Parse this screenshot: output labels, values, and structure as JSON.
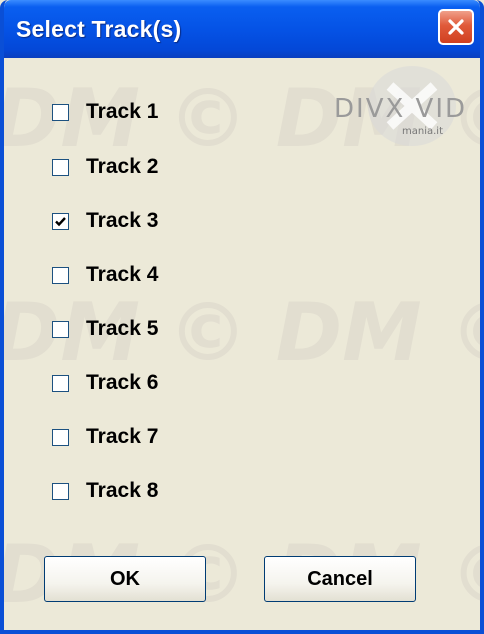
{
  "window": {
    "title": "Select Track(s)",
    "close_icon": "close-icon"
  },
  "watermark": {
    "text": "DM © DM ©",
    "logo_main": "DIVX VID",
    "logo_sub": "mania.it"
  },
  "tracks": [
    {
      "label": "Track 1",
      "checked": false
    },
    {
      "label": "Track 2",
      "checked": false
    },
    {
      "label": "Track 3",
      "checked": true
    },
    {
      "label": "Track 4",
      "checked": false
    },
    {
      "label": "Track 5",
      "checked": false
    },
    {
      "label": "Track 6",
      "checked": false
    },
    {
      "label": "Track 7",
      "checked": false
    },
    {
      "label": "Track 8",
      "checked": false
    }
  ],
  "buttons": {
    "ok_label": "OK",
    "cancel_label": "Cancel"
  },
  "colors": {
    "titlebar": "#0553e6",
    "dialog_bg": "#ece9d8",
    "close_button": "#e05a3a"
  }
}
